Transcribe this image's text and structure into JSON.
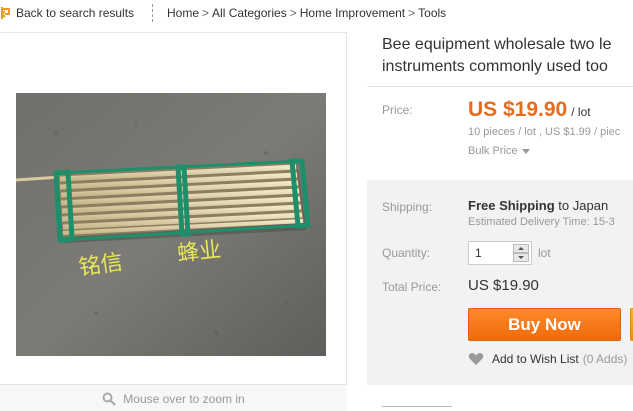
{
  "nav": {
    "back_label": "Back to search results",
    "breadcrumbs": [
      "Home",
      "All Categories",
      "Home Improvement",
      "Tools"
    ],
    "separator": ">"
  },
  "gallery": {
    "image_caption_text": "铭信 蜂业",
    "zoom_hint": "Mouse over to zoom in"
  },
  "product": {
    "title_line1": "Bee equipment wholesale two le",
    "title_line2": "instruments commonly used too"
  },
  "pricing": {
    "price_label": "Price:",
    "price": "US $19.90",
    "unit": "/ lot",
    "bulk_info": "10 pieces / lot , US $1.99 / piec",
    "bulk_price_label": "Bulk Price"
  },
  "shipping": {
    "label": "Shipping:",
    "free_text": "Free Shipping",
    "to_text": "to Japan",
    "estimate": "Estimated Delivery Time: 15-3"
  },
  "quantity": {
    "label": "Quantity:",
    "value": "1",
    "unit": "lot"
  },
  "total": {
    "label": "Total Price:",
    "value": "US $19.90"
  },
  "actions": {
    "buy_now": "Buy Now",
    "wishlist_label": "Add to Wish List",
    "wishlist_count": "(0 Adds)"
  },
  "colors": {
    "price_orange": "#e66b1d",
    "buy_button": "#ef6b0a",
    "panel_gray": "#f2f2f2"
  }
}
